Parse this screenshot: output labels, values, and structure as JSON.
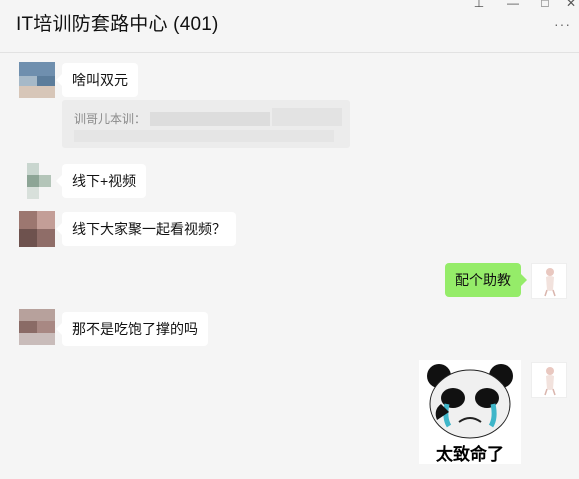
{
  "window": {
    "title": "IT培训防套路中心 (401)",
    "controls": {
      "pin": "⊥",
      "minimize": "—",
      "maximize": "□",
      "close": "✕"
    },
    "more_icon": "···"
  },
  "messages": [
    {
      "side": "left",
      "text": "啥叫双元"
    },
    {
      "side": "left",
      "quote_text": "训哥儿本训："
    },
    {
      "side": "left",
      "text": "线下+视频"
    },
    {
      "side": "left",
      "text": "线下大家聚一起看视频？"
    },
    {
      "side": "right",
      "text": "配个助教"
    },
    {
      "side": "left",
      "text": "那不是吃饱了撑的吗"
    },
    {
      "side": "right",
      "sticker_caption": "太致命了"
    }
  ],
  "colors": {
    "self_bubble": "#95ec69",
    "other_bubble": "#ffffff",
    "background": "#f5f5f5"
  }
}
